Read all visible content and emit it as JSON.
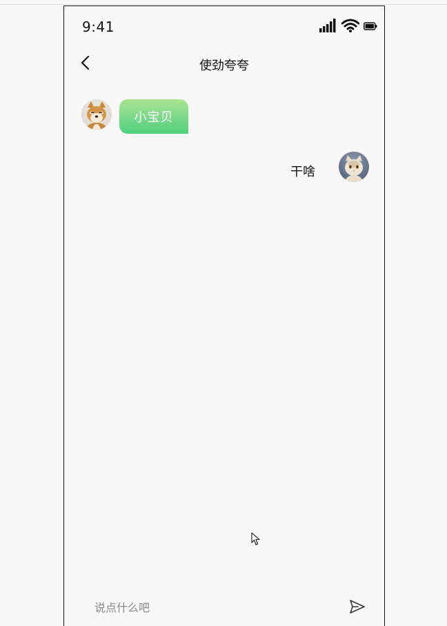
{
  "status_bar": {
    "time": "9:41",
    "icons": [
      "signal-icon",
      "wifi-icon",
      "battery-icon"
    ]
  },
  "nav": {
    "title": "使劲夸夸",
    "back_icon": "chevron-left-icon"
  },
  "messages": [
    {
      "side": "left",
      "text": "小宝贝",
      "avatar": "shiba-dog-avatar"
    },
    {
      "side": "right",
      "text": "干啥",
      "avatar": "cat-avatar"
    }
  ],
  "input": {
    "placeholder": "说点什么吧",
    "value": "",
    "send_icon": "send-icon"
  },
  "colors": {
    "bubble_top": "#a8e38f",
    "bubble_bottom": "#4fcf7a",
    "background": "#f7f7f7"
  }
}
